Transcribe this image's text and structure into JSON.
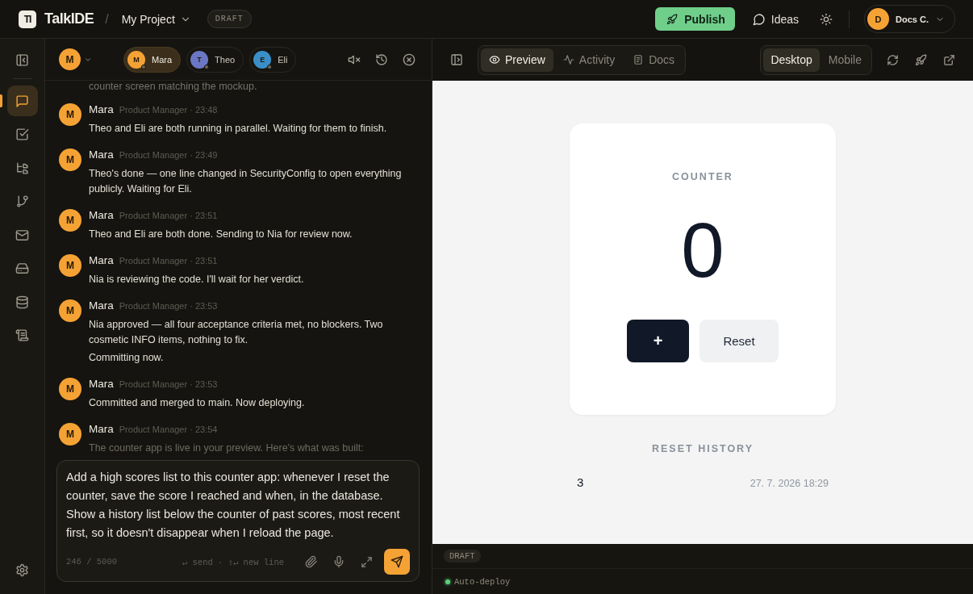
{
  "header": {
    "logo_mark": "TI",
    "app_name": "TalkIDE",
    "separator": "/",
    "project": "My Project",
    "badge": "DRAFT",
    "publish": "Publish",
    "ideas": "Ideas",
    "account": {
      "initial": "D",
      "name": "Docs C."
    }
  },
  "rail": [
    {
      "kind": "chat",
      "selected": true
    },
    {
      "kind": "tasks",
      "selected": false
    },
    {
      "kind": "tree",
      "selected": false
    },
    {
      "kind": "branch",
      "selected": false
    },
    {
      "kind": "mail",
      "selected": false
    },
    {
      "kind": "drive",
      "selected": false
    },
    {
      "kind": "database",
      "selected": false
    },
    {
      "kind": "scroll",
      "selected": false
    }
  ],
  "chat": {
    "me_initial": "M",
    "agents": [
      {
        "initial": "M",
        "name": "Mara",
        "color": "#f5a235",
        "selected": true
      },
      {
        "initial": "T",
        "name": "Theo",
        "color": "#6b77c4",
        "selected": false
      },
      {
        "initial": "E",
        "name": "Eli",
        "color": "#3a8fc9",
        "selected": false
      }
    ],
    "lead_text": "counter screen matching the mockup.",
    "messages": [
      {
        "initial": "M",
        "author": "Mara",
        "meta": "Product Manager · 23:48",
        "paragraphs": [
          "Theo and Eli are both running in parallel. Waiting for them to finish."
        ]
      },
      {
        "initial": "M",
        "author": "Mara",
        "meta": "Product Manager · 23:49",
        "paragraphs": [
          "Theo's done — one line changed in SecurityConfig to open everything publicly. Waiting for Eli."
        ]
      },
      {
        "initial": "M",
        "author": "Mara",
        "meta": "Product Manager · 23:51",
        "paragraphs": [
          "Theo and Eli are both done. Sending to Nia for review now."
        ]
      },
      {
        "initial": "M",
        "author": "Mara",
        "meta": "Product Manager · 23:51",
        "paragraphs": [
          "Nia is reviewing the code. I'll wait for her verdict."
        ]
      },
      {
        "initial": "M",
        "author": "Mara",
        "meta": "Product Manager · 23:53",
        "paragraphs": [
          "Nia approved — all four acceptance criteria met, no blockers. Two cosmetic INFO items, nothing to fix.",
          "Committing now."
        ]
      },
      {
        "initial": "M",
        "author": "Mara",
        "meta": "Product Manager · 23:53",
        "paragraphs": [
          "Committed and merged to main. Now deploying."
        ]
      },
      {
        "initial": "M",
        "author": "Mara",
        "meta": "Product Manager · 23:54",
        "paragraphs": [
          "The counter app is live in your preview. Here's what was built:"
        ]
      }
    ],
    "composer": {
      "value": "Add a high scores list to this counter app: whenever I reset the counter, save the score I reached and when, in the database. Show a history list below the counter of past scores, most recent first, so it doesn't disappear when I reload the page.",
      "count": "246 / 5000",
      "hint": "↵ send · ⇧↵ new line"
    }
  },
  "preview": {
    "tabs": [
      {
        "label": "Preview",
        "kind": "eye",
        "selected": true
      },
      {
        "label": "Activity",
        "kind": "activity",
        "selected": false
      },
      {
        "label": "Docs",
        "kind": "doc",
        "selected": false
      }
    ],
    "devices": [
      {
        "label": "Desktop",
        "selected": true
      },
      {
        "label": "Mobile",
        "selected": false
      }
    ],
    "app": {
      "counter_label": "COUNTER",
      "value": "0",
      "increment": "+",
      "reset": "Reset",
      "history_label": "RESET HISTORY",
      "history": [
        {
          "score": "3",
          "time": "27. 7. 2026 18:29"
        }
      ]
    },
    "status": {
      "badge": "DRAFT",
      "deploy": {
        "label": "Auto-deploy",
        "on": true
      }
    }
  }
}
